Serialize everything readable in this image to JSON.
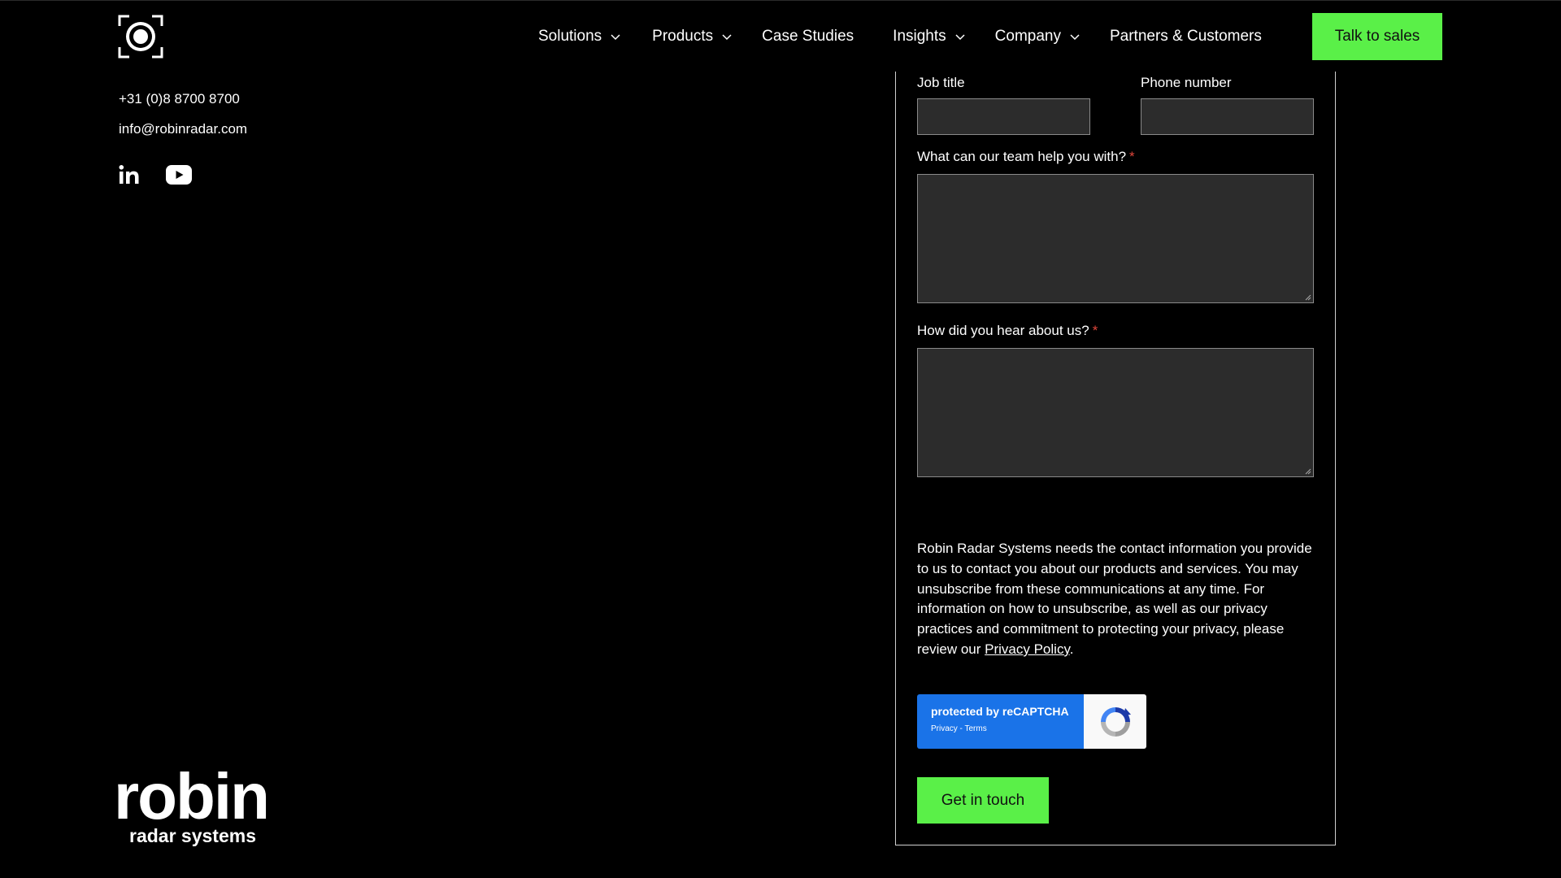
{
  "nav": {
    "items": [
      {
        "label": "Solutions",
        "dropdown": true
      },
      {
        "label": "Products",
        "dropdown": true
      },
      {
        "label": "Case Studies",
        "dropdown": false
      },
      {
        "label": "Insights",
        "dropdown": true
      },
      {
        "label": "Company",
        "dropdown": true
      },
      {
        "label": "Partners & Customers",
        "dropdown": false
      }
    ],
    "cta_label": "Talk to sales"
  },
  "contact": {
    "phone": "+31 (0)8 8700 8700",
    "email": "info@robinradar.com",
    "social": [
      "linkedin-icon",
      "youtube-icon"
    ]
  },
  "brand": {
    "name": "robin",
    "subtitle": "radar systems"
  },
  "form": {
    "job_title_label": "Job title",
    "phone_label": "Phone number",
    "help_label": "What can our team help you with?",
    "hear_label": "How did you hear about us?",
    "required_marker": "*",
    "consent_text": "Robin Radar Systems needs the contact information you provide to us to contact you about our products and services. You may unsubscribe from these communications at any time. For information on how to unsubscribe, as well as our privacy practices and commitment to protecting your privacy, please review our ",
    "privacy_link": "Privacy Policy",
    "consent_end": ".",
    "recaptcha_title": "protected by reCAPTCHA",
    "recaptcha_links": "Privacy - Terms",
    "submit_label": "Get in touch"
  },
  "colors": {
    "accent": "#5af048",
    "background": "#000000",
    "field_bg": "#2c2c2c",
    "required": "#e0463b",
    "recaptcha_blue": "#1a73e8"
  }
}
